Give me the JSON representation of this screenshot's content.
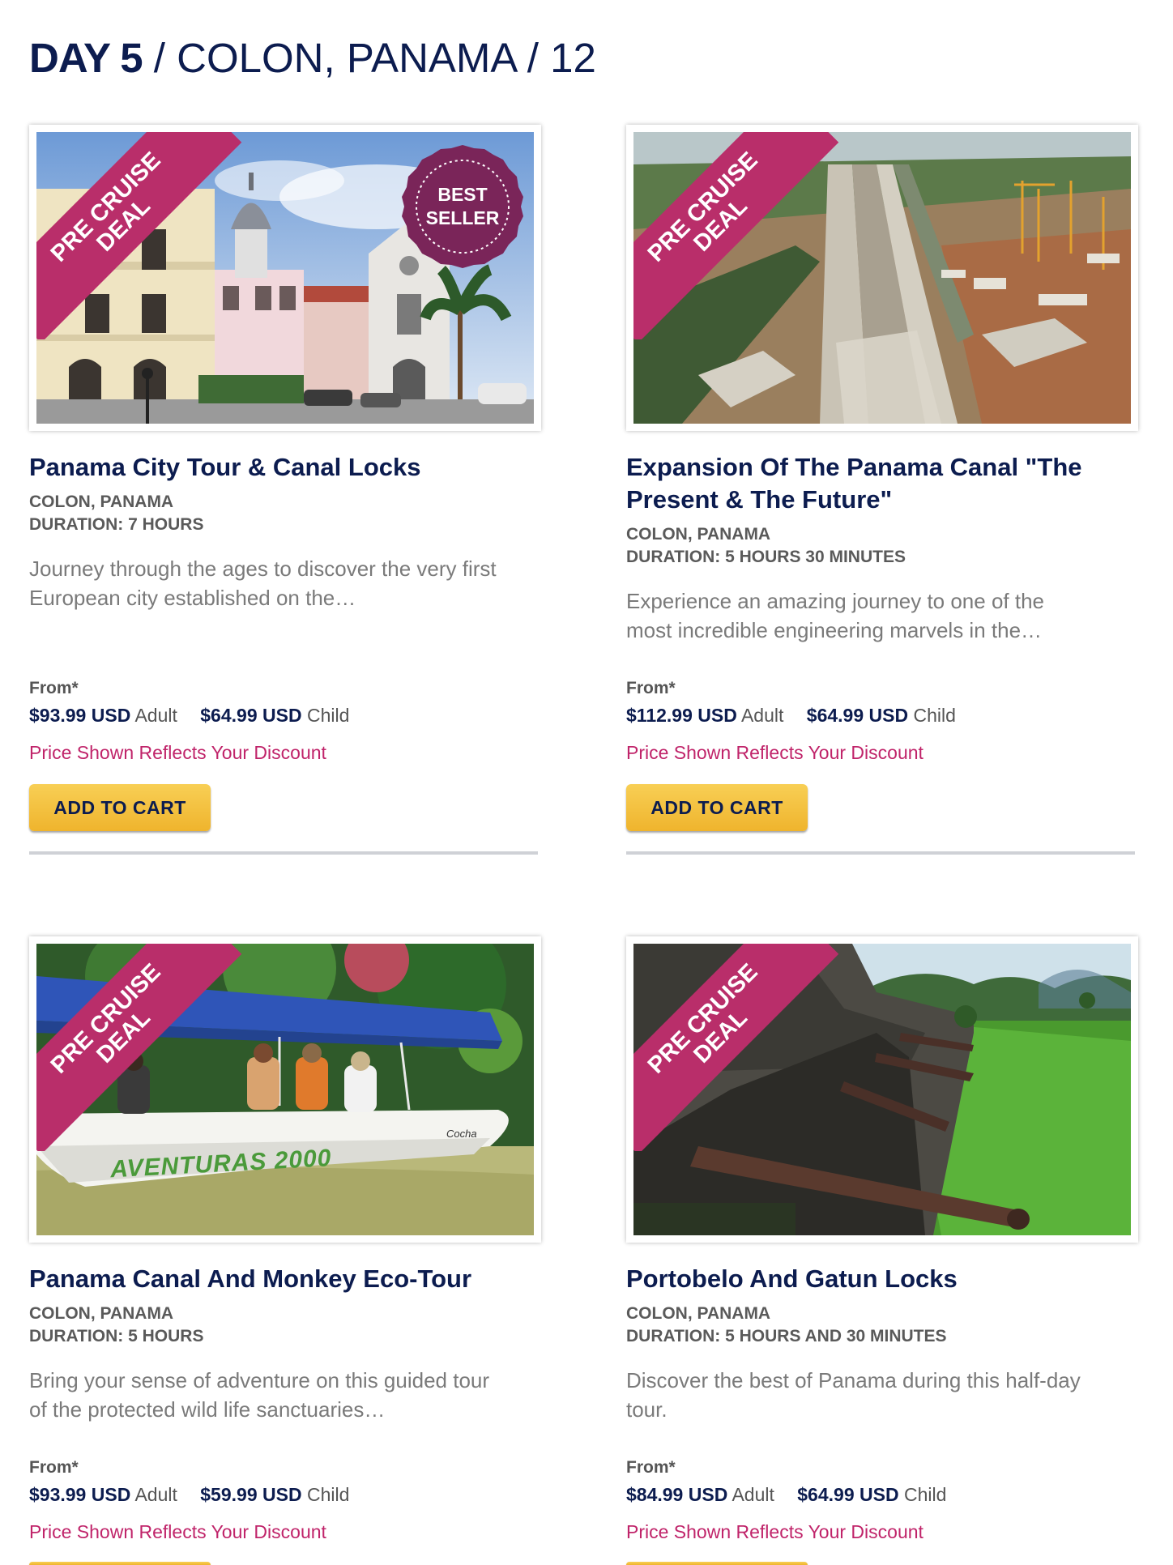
{
  "header": {
    "day": "DAY 5",
    "rest": " / COLON, PANAMA / 12"
  },
  "ribbon": {
    "line1": "PRE CRUISE",
    "line2": "DEAL"
  },
  "badge": {
    "line1": "BEST",
    "line2": "SELLER"
  },
  "colors": {
    "navy": "#0c1c4f",
    "ribbon": "#b92e6a",
    "discount": "#c0246a",
    "button": "#f4c140",
    "badge": "#7a2559"
  },
  "tours": [
    {
      "title_lines": [
        "Panama City Tour & Canal Locks"
      ],
      "location": "COLON, PANAMA",
      "duration": "DURATION: 7 HOURS",
      "desc_lines": [
        "Journey through the ages to discover the very first",
        "European city established on the…"
      ],
      "from": "From*",
      "adult_price": "$93.99 USD",
      "adult_label": "Adult",
      "child_price": "$64.99 USD",
      "child_label": "Child",
      "discount": "Price Shown Reflects Your Discount",
      "button": "ADD TO CART"
    },
    {
      "title_lines": [
        "Expansion Of The Panama Canal \"The",
        "Present & The Future\""
      ],
      "location": "COLON, PANAMA",
      "duration": "DURATION: 5 HOURS 30 MINUTES",
      "desc_lines": [
        "Experience an amazing journey to one of the",
        "most incredible engineering marvels in the…"
      ],
      "from": "From*",
      "adult_price": "$112.99 USD",
      "adult_label": "Adult",
      "child_price": "$64.99 USD",
      "child_label": "Child",
      "discount": "Price Shown Reflects Your Discount",
      "button": "ADD TO CART"
    },
    {
      "title_lines": [
        "Panama Canal And Monkey Eco-Tour"
      ],
      "location": "COLON, PANAMA",
      "duration": "DURATION: 5 HOURS",
      "desc_lines": [
        "Bring your sense of adventure on this guided tour",
        "of the protected wild life sanctuaries…"
      ],
      "from": "From*",
      "adult_price": "$93.99 USD",
      "adult_label": "Adult",
      "child_price": "$59.99 USD",
      "child_label": "Child",
      "discount": "Price Shown Reflects Your Discount",
      "boat_text": "AVENTURAS 2000",
      "boat_small": "Cocha"
    },
    {
      "title_lines": [
        "Portobelo And Gatun Locks"
      ],
      "location": "COLON, PANAMA",
      "duration": "DURATION: 5 HOURS AND 30 MINUTES",
      "desc_lines": [
        "Discover the best of Panama during this half-day",
        "tour."
      ],
      "from": "From*",
      "adult_price": "$84.99 USD",
      "adult_label": "Adult",
      "child_price": "$64.99 USD",
      "child_label": "Child",
      "discount": "Price Shown Reflects Your Discount"
    }
  ]
}
